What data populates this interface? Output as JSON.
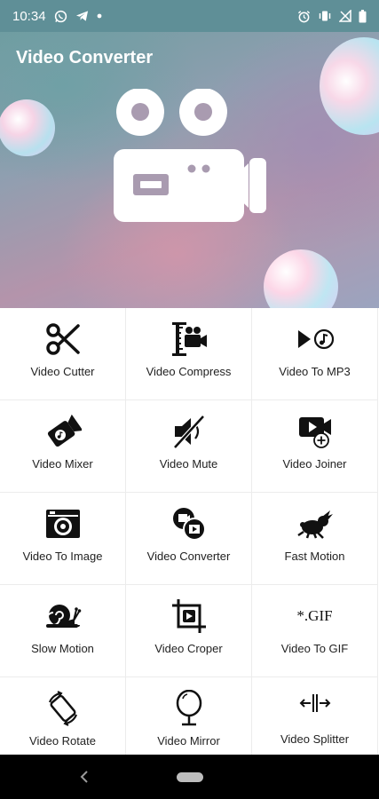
{
  "status_bar": {
    "time": "10:34",
    "left_icons": [
      "whatsapp-icon",
      "telegram-icon",
      "dot-icon"
    ],
    "right_icons": [
      "alarm-icon",
      "vibrate-icon",
      "no-signal-icon",
      "battery-icon"
    ]
  },
  "header": {
    "title": "Video Converter",
    "logo_icon": "video-camera-icon"
  },
  "colors": {
    "status_bar": "#5f8f97",
    "nav_bar": "#000000",
    "label_text": "#222222"
  },
  "tiles": [
    {
      "label": "Video Cutter",
      "icon": "scissors-icon"
    },
    {
      "label": "Video Compress",
      "icon": "compress-icon"
    },
    {
      "label": "Video To MP3",
      "icon": "play-music-icon"
    },
    {
      "label": "Video Mixer",
      "icon": "music-camera-icon"
    },
    {
      "label": "Video Mute",
      "icon": "mute-icon"
    },
    {
      "label": "Video Joiner",
      "icon": "video-add-icon"
    },
    {
      "label": "Video To Image",
      "icon": "camera-icon"
    },
    {
      "label": "Video Converter",
      "icon": "convert-icon"
    },
    {
      "label": "Fast Motion",
      "icon": "rabbit-icon"
    },
    {
      "label": "Slow Motion",
      "icon": "snail-icon"
    },
    {
      "label": "Video Croper",
      "icon": "crop-icon"
    },
    {
      "label": "Video To GIF",
      "icon": "gif-icon",
      "icon_text": "*.GIF"
    },
    {
      "label": "Video Rotate",
      "icon": "rotate-icon"
    },
    {
      "label": "Video Mirror",
      "icon": "mirror-icon"
    },
    {
      "label": "Video Splitter",
      "icon": "split-icon"
    }
  ],
  "nav_bar": {
    "back_icon": "back-icon",
    "home_icon": "home-pill-icon"
  }
}
